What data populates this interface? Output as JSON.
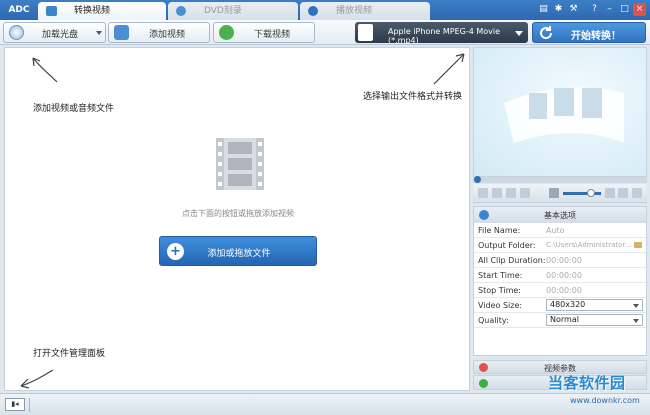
{
  "app": {
    "logo": "ADC"
  },
  "tabs": [
    {
      "label": "转换视频",
      "active": true
    },
    {
      "label": "DVD刻录",
      "active": false
    },
    {
      "label": "播放视频",
      "active": false
    }
  ],
  "window_controls": [
    "monitor-icon",
    "gear-icon",
    "tools-icon",
    "help-icon",
    "minimize-icon",
    "maximize-icon",
    "close-icon"
  ],
  "toolbar": {
    "load_disc": "加载光盘",
    "add_video": "添加视频",
    "download_video": "下载视频",
    "format": "Apple iPhone MPEG-4 Movie (*.mp4)",
    "start": "开始转换！"
  },
  "hints": {
    "add_file": "添加视频或音频文件",
    "select_format": "选择输出文件格式并转换",
    "open_manager": "打开文件管理面板"
  },
  "main": {
    "drop_hint": "点击下面的按钮或拖放添加视频",
    "add_drop_button": "添加或拖放文件"
  },
  "options": {
    "header": "基本选项",
    "rows": [
      {
        "key": "File Name:",
        "value": "Auto"
      },
      {
        "key": "Output Folder:",
        "value": "C:\\Users\\Administrator..."
      },
      {
        "key": "All Clip Duration:",
        "value": "00:00:00"
      },
      {
        "key": "Start Time:",
        "value": "00:00:00"
      },
      {
        "key": "Stop Time:",
        "value": "00:00:00"
      },
      {
        "key": "Video Size:",
        "value": "480x320"
      },
      {
        "key": "Quality:",
        "value": "Normal"
      }
    ]
  },
  "video_params": "视频参数",
  "player": {
    "volume_level": 0.7
  },
  "watermark": {
    "title": "当客软件园",
    "url": "www.downkr.com"
  },
  "colors": {
    "accent": "#2e6fb8",
    "title_bar": "#3c7fc7"
  }
}
